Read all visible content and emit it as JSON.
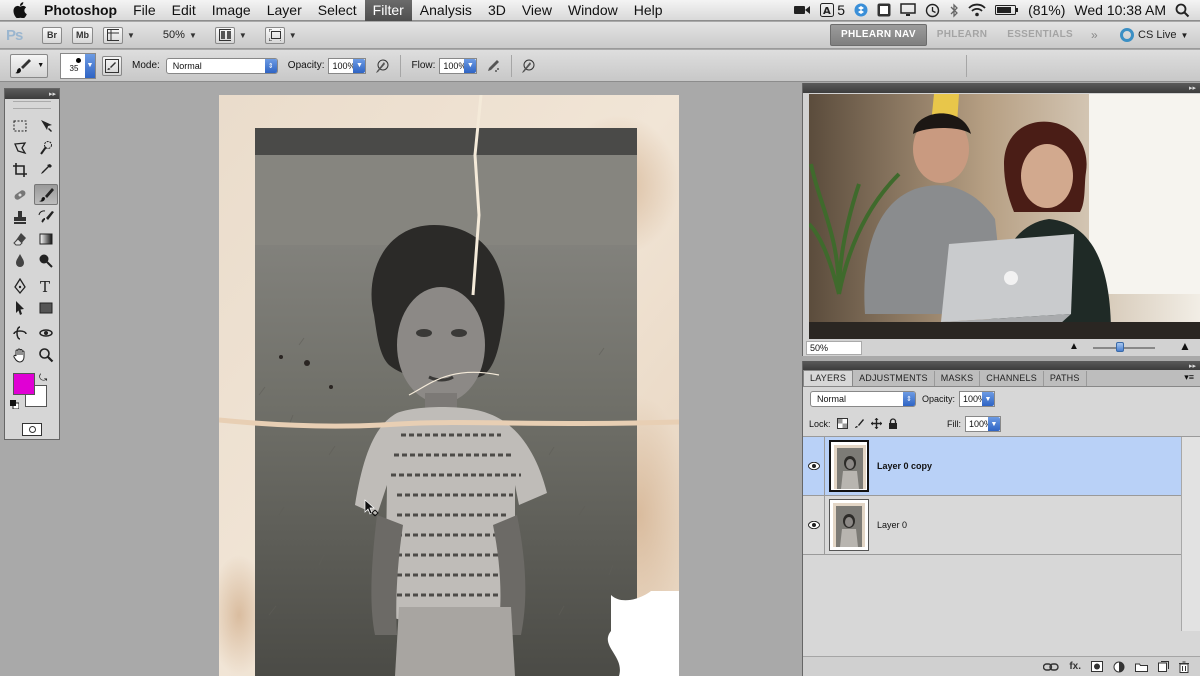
{
  "menubar": {
    "app_name": "Photoshop",
    "items": [
      "File",
      "Edit",
      "Image",
      "Layer",
      "Select",
      "Filter",
      "Analysis",
      "3D",
      "View",
      "Window",
      "Help"
    ],
    "status": {
      "adobe_count": "5",
      "battery": "(81%)",
      "clock": "Wed 10:38 AM"
    }
  },
  "appbar": {
    "logo": "Ps",
    "bridge": "Br",
    "minibridge": "Mb",
    "zoom": "50%",
    "workspaces": [
      "PHLEARN NAV",
      "PHLEARN",
      "ESSENTIALS"
    ],
    "more": "»",
    "cs_live": "CS Live"
  },
  "options": {
    "brush_size": "35",
    "mode_label": "Mode:",
    "mode_value": "Normal",
    "opacity_label": "Opacity:",
    "opacity_value": "100%",
    "flow_label": "Flow:",
    "flow_value": "100%"
  },
  "tools": {
    "foreground_color": "#e000d4",
    "background_color": "#ffffff"
  },
  "video": {
    "zoom": "50%"
  },
  "layers_panel": {
    "tabs": [
      "LAYERS",
      "ADJUSTMENTS",
      "MASKS",
      "CHANNELS",
      "PATHS"
    ],
    "blend_mode": "Normal",
    "opacity_label": "Opacity:",
    "opacity_value": "100%",
    "lock_label": "Lock:",
    "fill_label": "Fill:",
    "fill_value": "100%",
    "layers": [
      {
        "name": "Layer 0 copy",
        "selected": true
      },
      {
        "name": "Layer 0",
        "selected": false
      }
    ]
  }
}
